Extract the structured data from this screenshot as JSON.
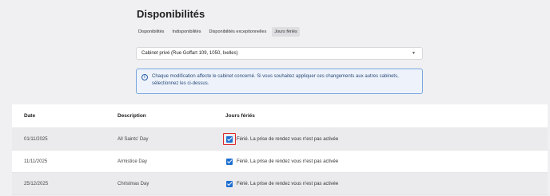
{
  "header": {
    "title": "Disponibilités",
    "tabs": [
      {
        "label": "Disponibilités",
        "active": false
      },
      {
        "label": "Indisponibilités",
        "active": false
      },
      {
        "label": "Disponibilités exceptionnelles",
        "active": false
      },
      {
        "label": "Jours fériés",
        "active": true
      }
    ]
  },
  "cabinet_select": {
    "value": "Cabinet privé (Rue Goffart 109, 1050, Ixelles)"
  },
  "info_banner": {
    "icon": "info-icon",
    "text": "Chaque modification affecte le cabinet concerné. Si vous souhaitez appliquer ces changements aux autres cabinets, sélectionnez les ci-dessus."
  },
  "table": {
    "columns": [
      "Date",
      "Description",
      "Jours fériés"
    ],
    "rows": [
      {
        "date": "01/11/2025",
        "description": "All Saints' Day",
        "checked": true,
        "label": "Férié. La prise de rendez vous n'est pas activée"
      },
      {
        "date": "11/11/2025",
        "description": "Armistice Day",
        "checked": true,
        "label": "Férié. La prise de rendez vous n'est pas activée"
      },
      {
        "date": "25/12/2025",
        "description": "Christmas Day",
        "checked": true,
        "label": "Férié. La prise de rendez vous n'est pas activée"
      }
    ]
  },
  "colors": {
    "accent": "#1e6fd0",
    "highlight": "#e0262b",
    "info_border": "#7aa6de"
  }
}
